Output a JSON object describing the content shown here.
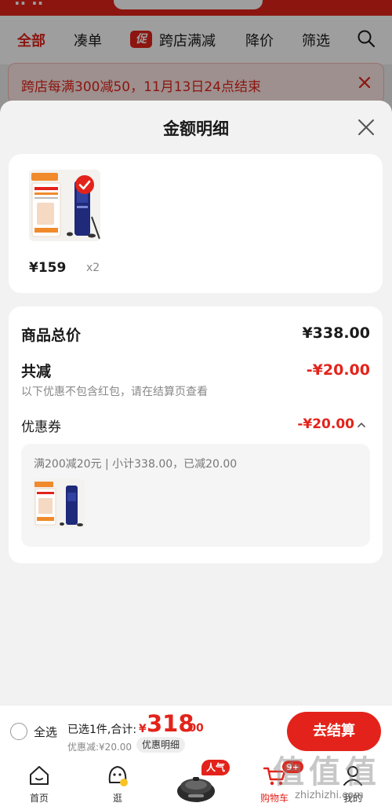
{
  "header": {
    "tabs": [
      {
        "label": "全部",
        "active": true
      },
      {
        "label": "凑单"
      },
      {
        "label": "跨店满减",
        "badge": "促"
      },
      {
        "label": "降价"
      },
      {
        "label": "筛选"
      }
    ]
  },
  "notice": {
    "text": "跨店每满300减50，11月13日24点结束"
  },
  "sheet": {
    "title": "金额明细",
    "product": {
      "price": "¥159",
      "quantity": "x2"
    },
    "summary": {
      "total_label": "商品总价",
      "total_value": "¥338.00",
      "reduction_label": "共减",
      "reduction_value": "-¥20.00",
      "reduction_note": "以下优惠不包含红包，请在结算页查看",
      "coupon_label": "优惠券",
      "coupon_value": "-¥20.00",
      "coupon_desc": "满200减20元 | 小计338.00，已减20.00"
    }
  },
  "checkout": {
    "select_all": "全选",
    "selected_text": "已选1件,合计:",
    "currency": "¥",
    "total_int": "318",
    "total_dec": ".00",
    "discount": "优惠减:¥20.00",
    "detail_chip": "优惠明细",
    "button": "去结算"
  },
  "tabbar": {
    "items": [
      {
        "label": "首页",
        "icon": "home-icon"
      },
      {
        "label": "逛",
        "icon": "explore-icon"
      },
      {
        "label": "",
        "icon": "promo-product-icon",
        "badge": "人气"
      },
      {
        "label": "购物车",
        "icon": "cart-icon",
        "badge": "9+",
        "active": true
      },
      {
        "label": "我的",
        "icon": "profile-icon"
      }
    ]
  },
  "watermark": {
    "glyphs": "值 值 值",
    "text": "zhizhizhi.com"
  },
  "colors": {
    "accent": "#e3231b",
    "sheet_bg": "#f2f2f2",
    "notice_bg": "#fde8e6"
  }
}
